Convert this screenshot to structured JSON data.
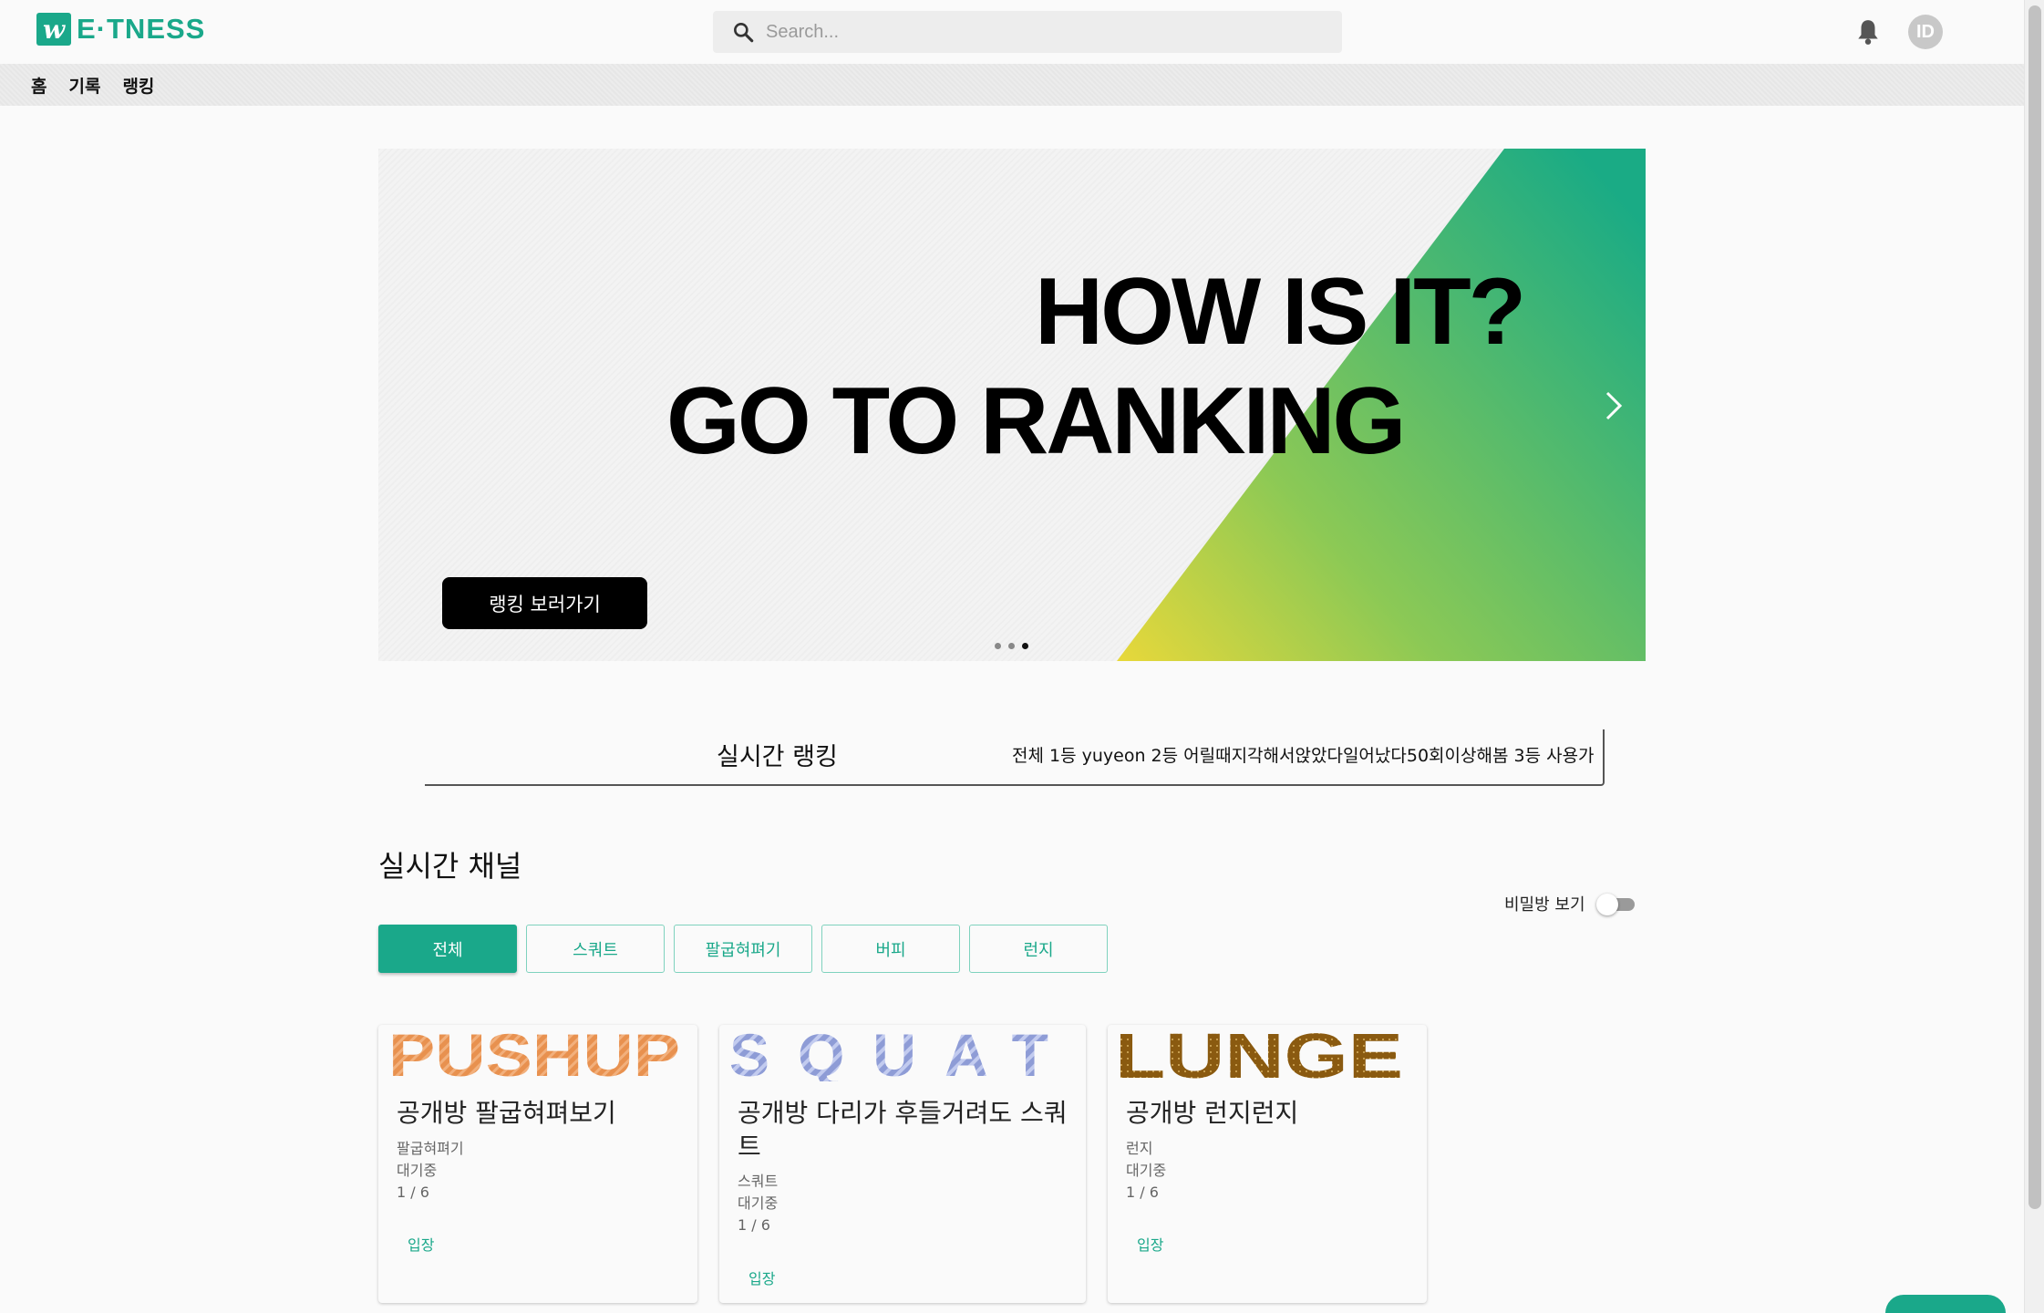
{
  "header": {
    "logo_mark": "w",
    "logo_text": "E·TNESS",
    "search_placeholder": "Search...",
    "avatar_text": "ID",
    "brand_color": "#1aa88a"
  },
  "nav": {
    "items": [
      "홈",
      "기록",
      "랭킹"
    ]
  },
  "banner": {
    "line1": "HOW IS IT?",
    "line2": "GO TO RANKING",
    "button_label": "랭킹 보러가기",
    "dots_total": 3,
    "active_dot": 3,
    "gradient_colors": [
      "#e8d83a",
      "#8cc955",
      "#1aab85"
    ]
  },
  "ranking": {
    "title": "실시간 랭킹",
    "ticker": "전체 1등 yuyeon 2등 어릴때지각해서앉았다일어났다50회이상해봄 3등 사용가"
  },
  "channels": {
    "title": "실시간 채널",
    "secret_label": "비밀방 보기",
    "secret_enabled": false,
    "filters": [
      "전체",
      "스쿼트",
      "팔굽혀펴기",
      "버피",
      "런지"
    ],
    "active_filter": "전체",
    "cards": [
      {
        "image_text": "PUSHUP",
        "title": "공개방 팔굽혀펴보기",
        "category": "팔굽혀펴기",
        "status": "대기중",
        "count": "1 / 6",
        "enter": "입장"
      },
      {
        "image_text": "SQUAT",
        "title": "공개방 다리가 후들거려도 스쿼트",
        "category": "스쿼트",
        "status": "대기중",
        "count": "1 / 6",
        "enter": "입장"
      },
      {
        "image_text": "LUNGE",
        "title": "공개방 런지런지",
        "category": "런지",
        "status": "대기중",
        "count": "1 / 6",
        "enter": "입장"
      }
    ]
  }
}
